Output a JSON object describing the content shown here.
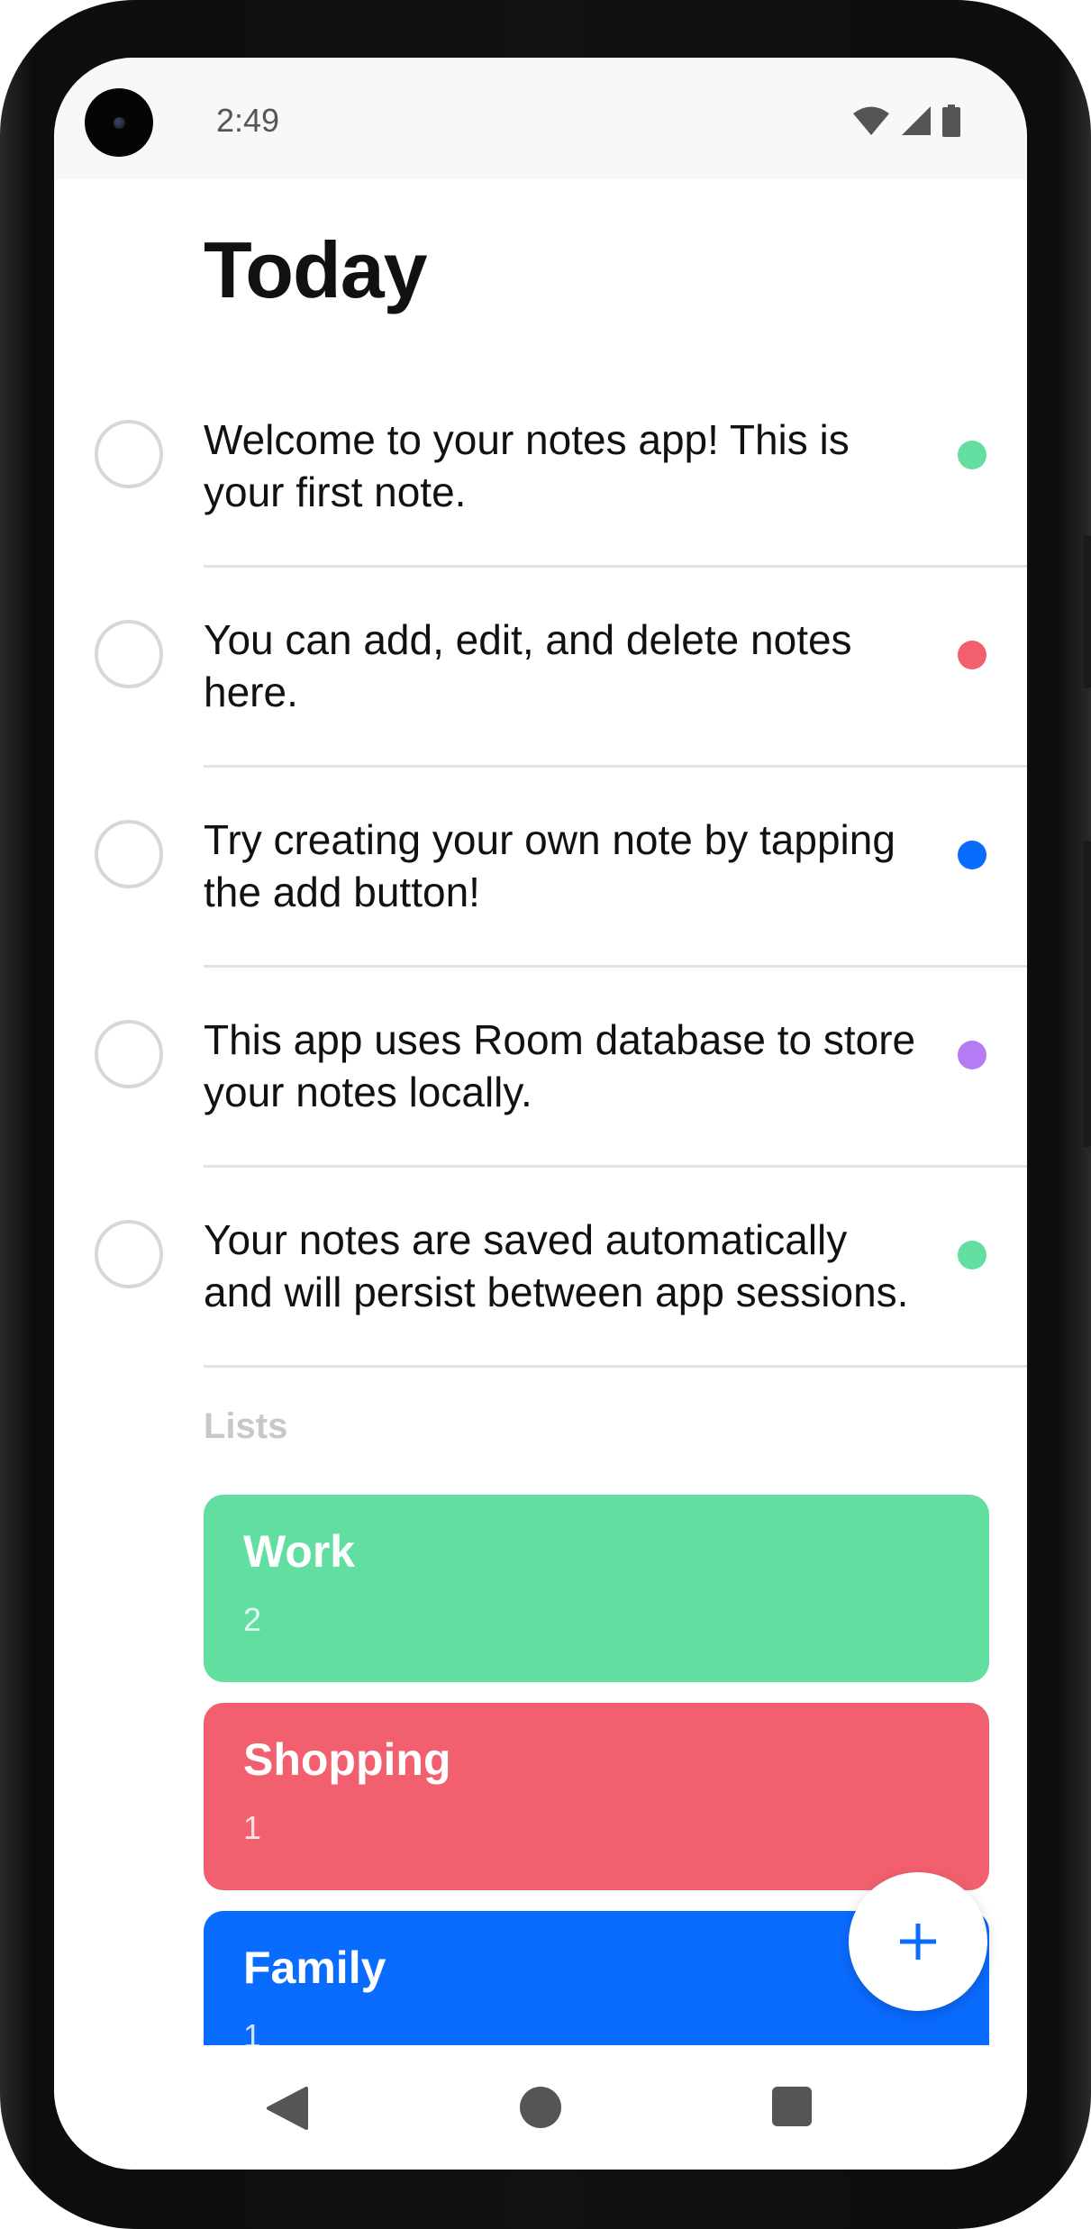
{
  "status_bar": {
    "time": "2:49",
    "icons": [
      "wifi-icon",
      "signal-icon",
      "battery-icon"
    ]
  },
  "page": {
    "title": "Today"
  },
  "notes": [
    {
      "text": "Welcome to your notes app! This is your first note.",
      "dot_color": "#62DFA0",
      "completed": false
    },
    {
      "text": "You can add, edit, and delete notes here.",
      "dot_color": "#F2606F",
      "completed": false
    },
    {
      "text": "Try creating your own note by tapping the add button!",
      "dot_color": "#0A6BFF",
      "completed": false
    },
    {
      "text": "This app uses Room database to store your notes locally.",
      "dot_color": "#B57BF5",
      "completed": false
    },
    {
      "text": "Your notes are saved automatically and will persist between app sessions.",
      "dot_color": "#62DFA0",
      "completed": false
    }
  ],
  "lists_section": {
    "label": "Lists",
    "items": [
      {
        "name": "Work",
        "count": "2",
        "color": "#62DFA0"
      },
      {
        "name": "Shopping",
        "count": "1",
        "color": "#F2606F"
      },
      {
        "name": "Family",
        "count": "1",
        "color": "#0A6BFF"
      }
    ]
  },
  "fab": {
    "icon": "plus-icon",
    "color": "#0A6BFF"
  },
  "nav": {
    "icons": [
      "back-icon",
      "home-icon",
      "recents-icon"
    ]
  }
}
